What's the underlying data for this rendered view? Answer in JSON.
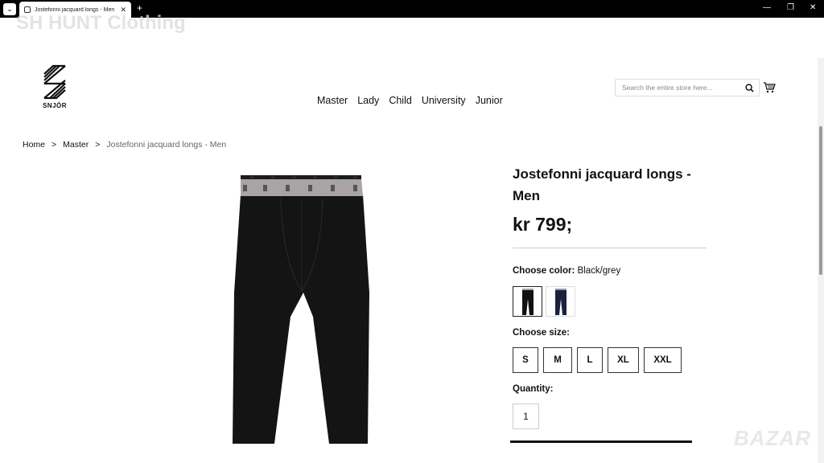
{
  "browser": {
    "tab_title": "Jostefonni jacquard longs - Men",
    "tab_close": "✕",
    "new_tab": "+",
    "menu_icon": "⌄",
    "minimize": "—",
    "restore": "❐",
    "close": "✕"
  },
  "watermark": "SH HUNT Clothing",
  "brand": {
    "logo_text": "SNJÓR"
  },
  "nav": {
    "items": [
      "Master",
      "Lady",
      "Child",
      "University",
      "Junior"
    ]
  },
  "search": {
    "placeholder": "Search the entire store here..."
  },
  "breadcrumb": {
    "home": "Home",
    "sep1": ">",
    "category": "Master",
    "sep2": ">",
    "current": "Jostefonni jacquard longs - Men"
  },
  "product": {
    "title": "Jostefonni jacquard longs - Men",
    "price": "kr 799;",
    "color_label": "Choose color:",
    "color_value": "Black/grey",
    "size_label": "Choose size:",
    "sizes": [
      "S",
      "M",
      "L",
      "XL",
      "XXL"
    ],
    "quantity_label": "Quantity:",
    "quantity": "1"
  },
  "footer_watermark": "BAZAR",
  "colors": {
    "accent": "#111111",
    "waistband": "#a9a3a3"
  }
}
